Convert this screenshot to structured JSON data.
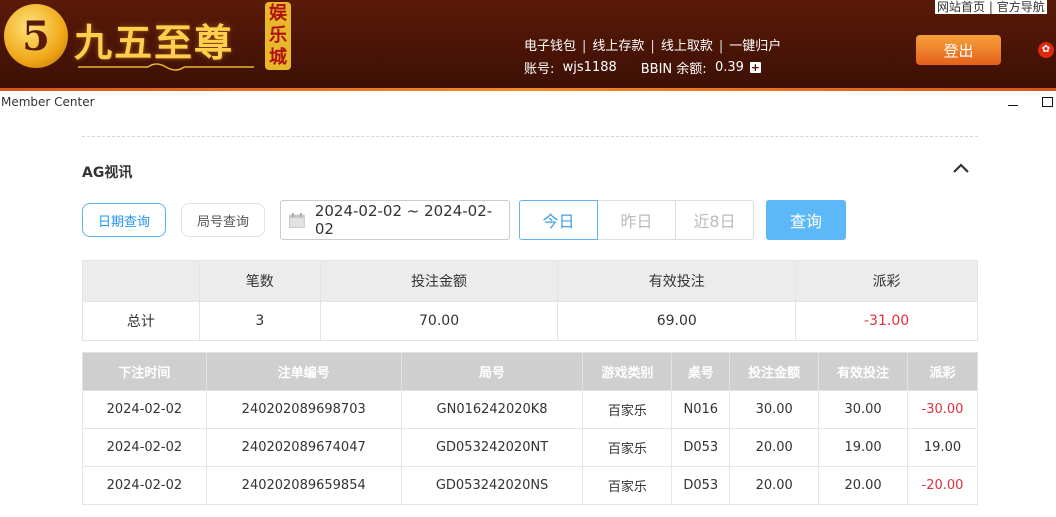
{
  "header": {
    "logo_glyph": "5",
    "logo_text": "九五至尊",
    "logo_sub": "娱乐城",
    "top_links": [
      "网站首页",
      "官方导航"
    ],
    "nav": [
      "电子钱包",
      "线上存款",
      "线上取款",
      "一键归户"
    ],
    "account_label": "账号:",
    "account_value": "wjs1188",
    "balance_label": "BBIN 余额:",
    "balance_value": "0.39",
    "logout": "登出"
  },
  "window": {
    "title": "Member Center"
  },
  "section": {
    "title": "AG视讯"
  },
  "filters": {
    "tab_date": "日期查询",
    "tab_round": "局号查询",
    "date_range": "2024-02-02 ~ 2024-02-02",
    "quick": [
      "今日",
      "昨日",
      "近8日"
    ],
    "query": "查询"
  },
  "summary": {
    "headers": [
      "",
      "笔数",
      "投注金额",
      "有效投注",
      "派彩"
    ],
    "row": [
      "总计",
      "3",
      "70.00",
      "69.00",
      "-31.00"
    ]
  },
  "detail": {
    "headers": [
      "下注时间",
      "注单编号",
      "局号",
      "游戏类别",
      "桌号",
      "投注金额",
      "有效投注",
      "派彩"
    ],
    "rows": [
      [
        "2024-02-02",
        "240202089698703",
        "GN016242020K8",
        "百家乐",
        "N016",
        "30.00",
        "30.00",
        "-30.00"
      ],
      [
        "2024-02-02",
        "240202089674047",
        "GD053242020NT",
        "百家乐",
        "D053",
        "20.00",
        "19.00",
        "19.00"
      ],
      [
        "2024-02-02",
        "240202089659854",
        "GD053242020NS",
        "百家乐",
        "D053",
        "20.00",
        "20.00",
        "-20.00"
      ]
    ]
  },
  "colors": {
    "accent": "#5cb8f7",
    "negative": "#e0303e",
    "header_bg": "#4a1406"
  }
}
